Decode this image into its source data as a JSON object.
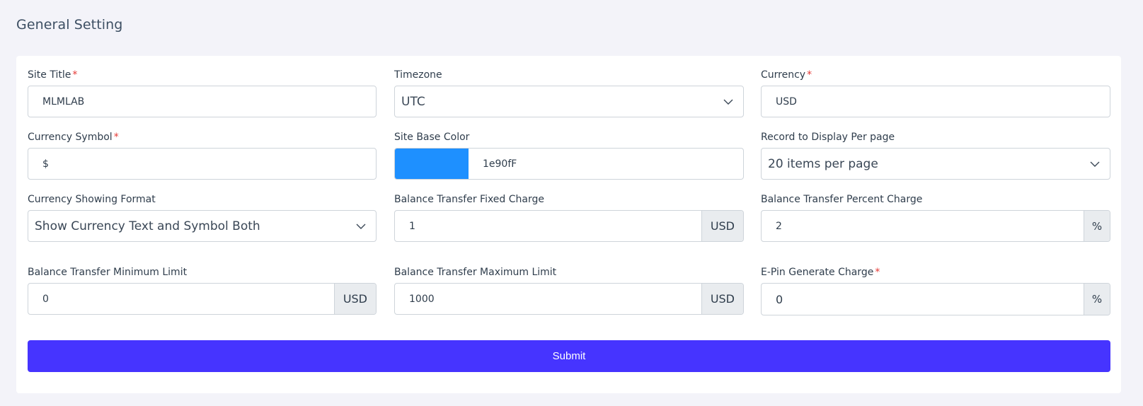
{
  "page": {
    "title": "General Setting"
  },
  "form": {
    "site_title": {
      "label": "Site Title",
      "required": "*",
      "value": "MLMLAB"
    },
    "timezone": {
      "label": "Timezone",
      "value": "UTC"
    },
    "currency": {
      "label": "Currency",
      "required": "*",
      "value": "USD"
    },
    "currency_symbol": {
      "label": "Currency Symbol",
      "required": "*",
      "value": "$"
    },
    "site_base_color": {
      "label": "Site Base Color",
      "value": "1e90fF",
      "swatch": "#1e90ff"
    },
    "records_per_page": {
      "label": "Record to Display Per page",
      "value": "20 items per page"
    },
    "currency_format": {
      "label": "Currency Showing Format",
      "value": "Show Currency Text and Symbol Both"
    },
    "bt_fixed_charge": {
      "label": "Balance Transfer Fixed Charge",
      "value": "1",
      "addon": "USD"
    },
    "bt_percent_charge": {
      "label": "Balance Transfer Percent Charge",
      "value": "2",
      "addon": "%"
    },
    "bt_min_limit": {
      "label": "Balance Transfer Minimum Limit",
      "value": "0",
      "addon": "USD"
    },
    "bt_max_limit": {
      "label": "Balance Transfer Maximum Limit",
      "value": "1000",
      "addon": "USD"
    },
    "epin_charge": {
      "label": "E-Pin Generate Charge",
      "required": "*",
      "value": "0",
      "addon": "%"
    },
    "submit_label": "Submit"
  },
  "colors": {
    "accent": "#4634ff",
    "base_color": "#1e90ff",
    "background": "#f3f3f9"
  },
  "icons": {
    "select_chevron": "chevron-down-icon"
  }
}
